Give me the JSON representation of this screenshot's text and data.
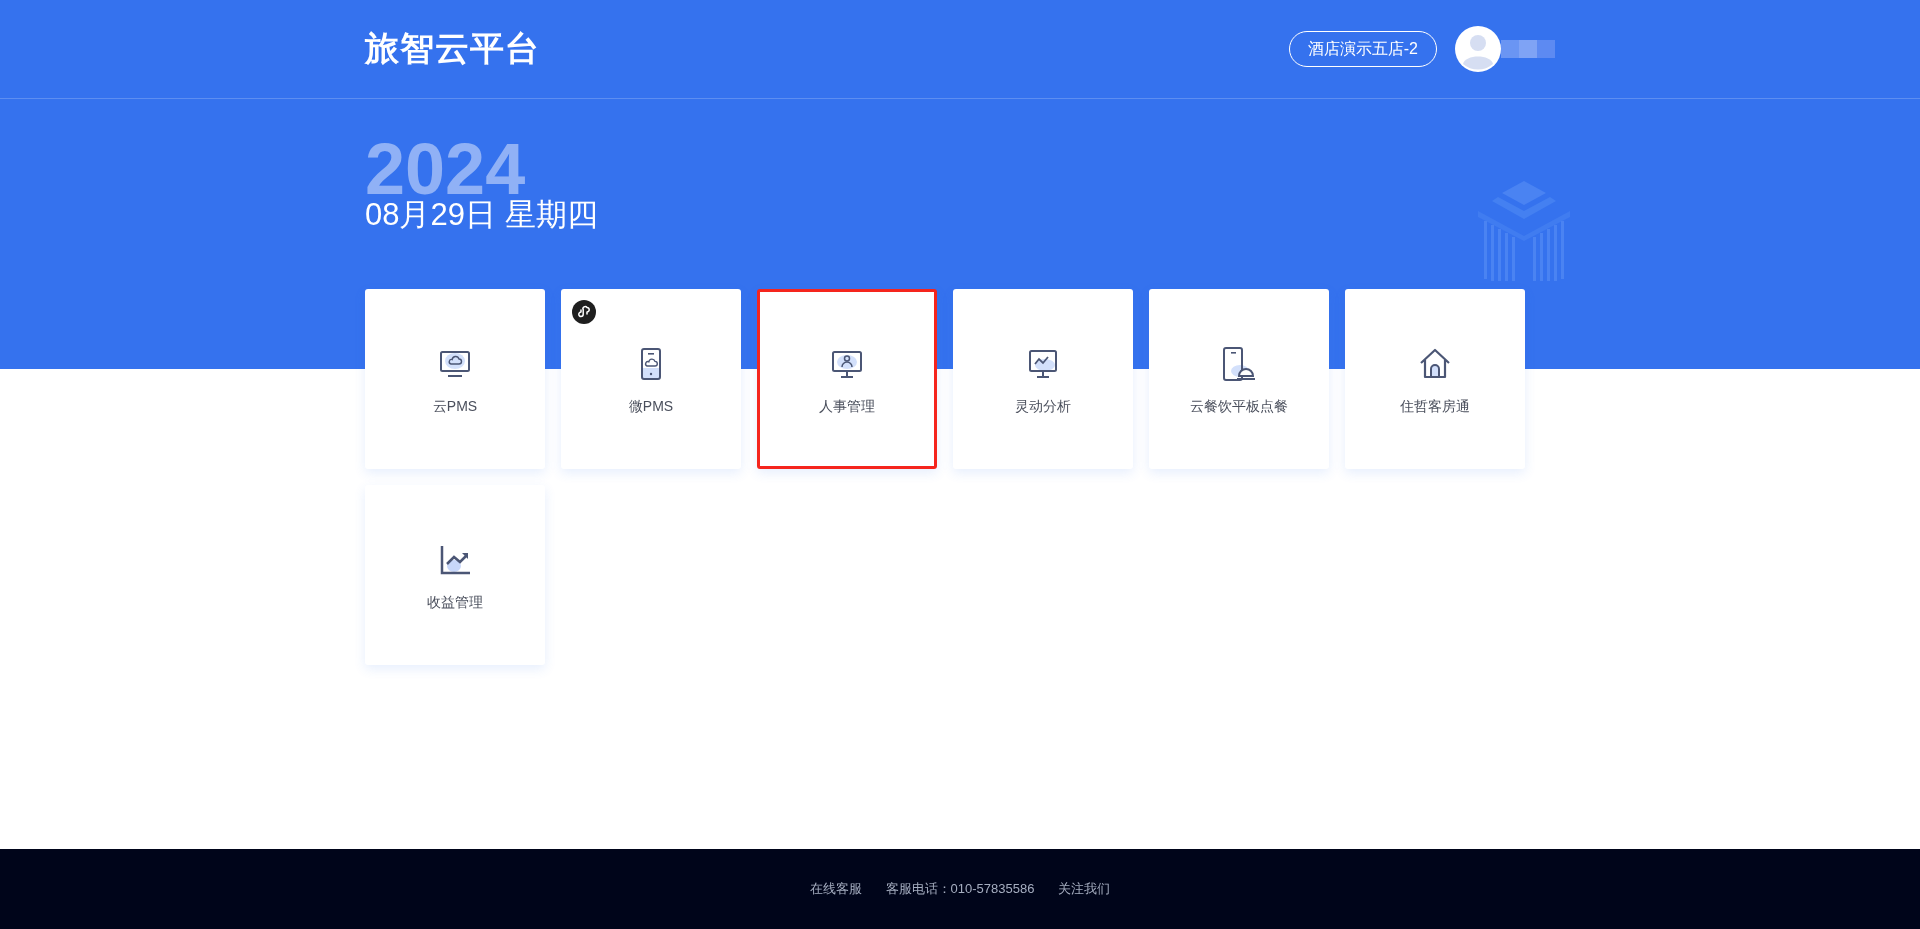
{
  "header": {
    "title": "旅智云平台",
    "store_button": "酒店演示五店-2"
  },
  "hero": {
    "year": "2024",
    "date": "08月29日 星期四"
  },
  "apps": [
    {
      "label": "云PMS",
      "selected": false,
      "mini_program": false
    },
    {
      "label": "微PMS",
      "selected": false,
      "mini_program": true
    },
    {
      "label": "人事管理",
      "selected": true,
      "mini_program": false
    },
    {
      "label": "灵动分析",
      "selected": false,
      "mini_program": false
    },
    {
      "label": "云餐饮平板点餐",
      "selected": false,
      "mini_program": false
    },
    {
      "label": "住哲客房通",
      "selected": false,
      "mini_program": false
    },
    {
      "label": "收益管理",
      "selected": false,
      "mini_program": false
    }
  ],
  "footer": {
    "links": [
      "在线客服",
      "客服电话：010-57835586",
      "关注我们"
    ]
  }
}
